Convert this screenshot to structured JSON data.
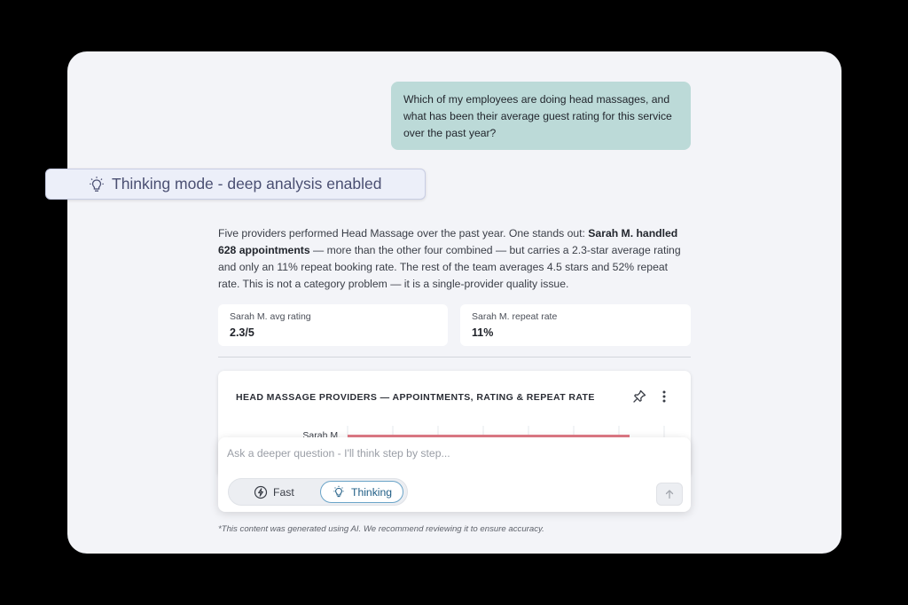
{
  "conversation": {
    "user_message": "Which of my employees are doing head massages, and what has been their average guest rating for this service over the past year?",
    "answer": {
      "intro": "Five providers performed Head Massage over the past year. One stands out: ",
      "highlight": "Sarah M. handled 628 appointments",
      "rest": " — more than the other four combined — but carries a 2.3-star average rating and only an 11% repeat booking rate. The rest of the team averages 4.5 stars and 52% repeat rate. This is not a category problem — it is a single-provider quality issue."
    },
    "metrics": [
      {
        "label": "Sarah M. avg rating",
        "value": "2.3/5"
      },
      {
        "label": "Sarah M. repeat rate",
        "value": "11%"
      }
    ]
  },
  "chart": {
    "title": "HEAD MASSAGE PROVIDERS — APPOINTMENTS, RATING & REPEAT RATE",
    "first_row_label": "Sarah M.",
    "pin_icon": "pin-icon",
    "more_icon": "more-vertical-icon",
    "accent_color": "#e07a86"
  },
  "composer": {
    "placeholder": "Ask a deeper question - I'll think step by step...",
    "value": "",
    "modes": {
      "fast": "Fast",
      "thinking": "Thinking",
      "selected": "Thinking"
    }
  },
  "disclaimer": "*This content was generated using AI. We recommend reviewing it to ensure accuracy.",
  "banner": {
    "text": "Thinking mode - deep analysis enabled",
    "icon": "lightbulb-icon"
  },
  "colors": {
    "user_bubble": "#bcdad8",
    "thinking_accent": "#1f5d85",
    "card_bg": "#f3f4f8"
  }
}
